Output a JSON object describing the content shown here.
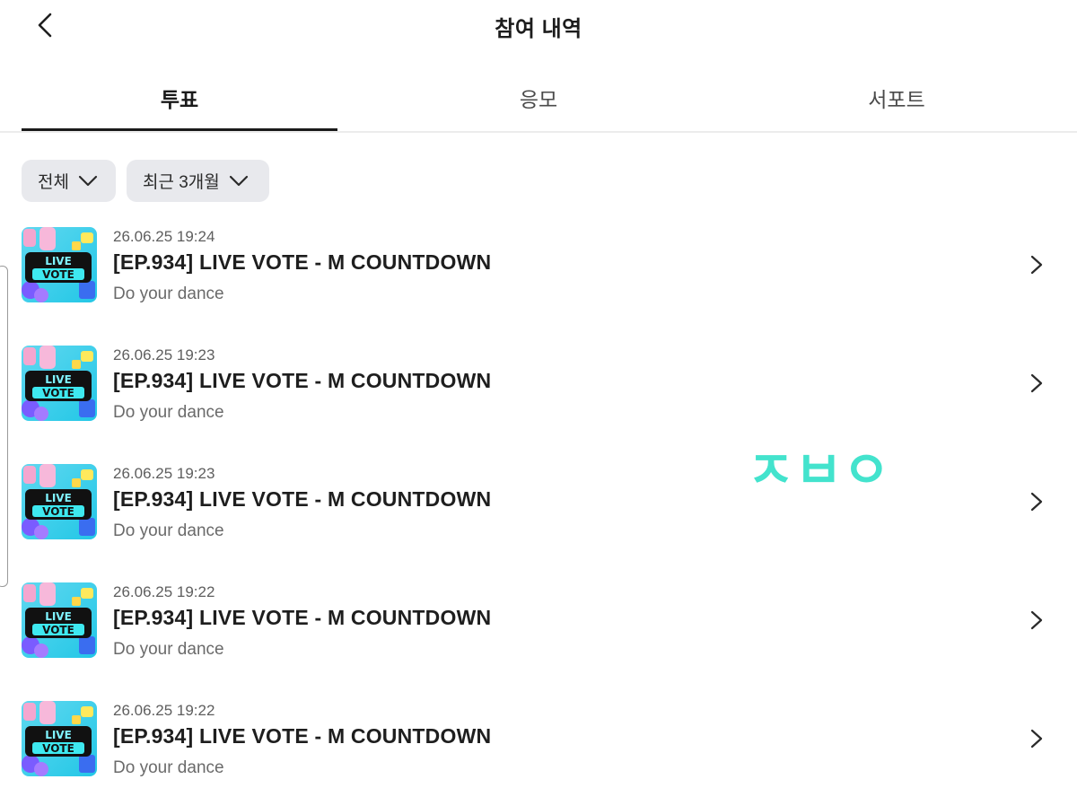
{
  "header": {
    "title": "참여 내역",
    "back_icon": "chevron-left-icon"
  },
  "tabs": [
    {
      "label": "투표",
      "active": true
    },
    {
      "label": "응모",
      "active": false
    },
    {
      "label": "서포트",
      "active": false
    }
  ],
  "filters": [
    {
      "label": "전체",
      "icon": "chevron-down-icon"
    },
    {
      "label": "최근 3개월",
      "icon": "chevron-down-icon"
    }
  ],
  "list": [
    {
      "date": "26.06.25 19:24",
      "title": "[EP.934] LIVE VOTE - M COUNTDOWN",
      "subtitle": "Do your dance",
      "thumb_line1": "LIVE",
      "thumb_line2": "VOTE"
    },
    {
      "date": "26.06.25 19:23",
      "title": "[EP.934] LIVE VOTE - M COUNTDOWN",
      "subtitle": "Do your dance",
      "thumb_line1": "LIVE",
      "thumb_line2": "VOTE"
    },
    {
      "date": "26.06.25 19:23",
      "title": "[EP.934] LIVE VOTE - M COUNTDOWN",
      "subtitle": "Do your dance",
      "thumb_line1": "LIVE",
      "thumb_line2": "VOTE"
    },
    {
      "date": "26.06.25 19:22",
      "title": "[EP.934] LIVE VOTE - M COUNTDOWN",
      "subtitle": "Do your dance",
      "thumb_line1": "LIVE",
      "thumb_line2": "VOTE"
    },
    {
      "date": "26.06.25 19:22",
      "title": "[EP.934] LIVE VOTE - M COUNTDOWN",
      "subtitle": "Do your dance",
      "thumb_line1": "LIVE",
      "thumb_line2": "VOTE"
    }
  ],
  "watermark": {
    "text": "ㅈㅂㅇ",
    "color": "#2fe0c8"
  },
  "colors": {
    "active_tab": "#1a1a1a",
    "filter_bg": "#e8e9ed",
    "thumb_teal": "#2fd9d0",
    "thumb_pink": "#f4a6cf"
  }
}
